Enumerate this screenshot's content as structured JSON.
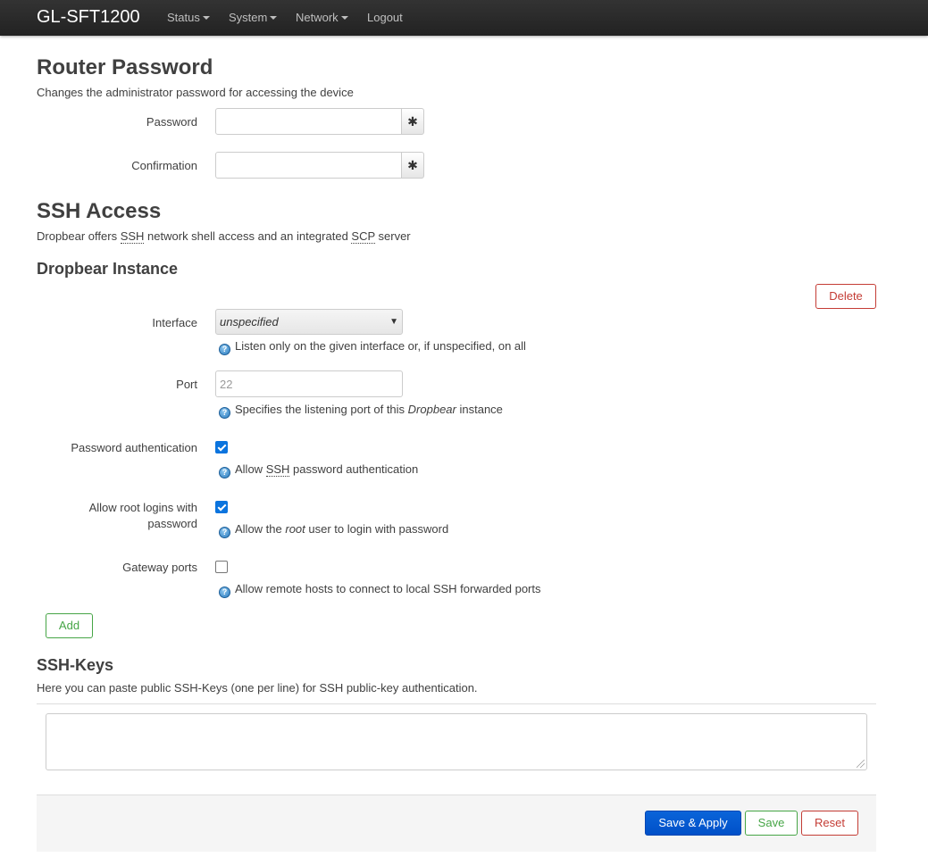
{
  "navbar": {
    "brand": "GL-SFT1200",
    "menus": [
      {
        "label": "Status"
      },
      {
        "label": "System"
      },
      {
        "label": "Network"
      }
    ],
    "logout": "Logout"
  },
  "router_password": {
    "title": "Router Password",
    "description": "Changes the administrator password for accessing the device",
    "password_label": "Password",
    "confirmation_label": "Confirmation",
    "reveal_symbol": "✱"
  },
  "ssh_access": {
    "title": "SSH Access",
    "desc_prefix": "Dropbear offers ",
    "desc_ssh": "SSH",
    "desc_middle": " network shell access and an integrated ",
    "desc_scp": "SCP",
    "desc_suffix": " server",
    "instance_title": "Dropbear Instance",
    "delete_label": "Delete",
    "interface": {
      "label": "Interface",
      "value": "unspecified",
      "arrow": "▼",
      "hint": "Listen only on the given interface or, if unspecified, on all"
    },
    "port": {
      "label": "Port",
      "placeholder": "22",
      "hint_prefix": "Specifies the listening port of this ",
      "hint_em": "Dropbear",
      "hint_suffix": " instance"
    },
    "password_auth": {
      "label": "Password authentication",
      "checked": true,
      "hint_prefix": "Allow ",
      "hint_abbr": "SSH",
      "hint_suffix": " password authentication"
    },
    "root_login": {
      "label_line1": "Allow root logins with",
      "label_line2": "password",
      "checked": true,
      "hint_prefix": "Allow the ",
      "hint_em": "root",
      "hint_suffix": " user to login with password"
    },
    "gateway_ports": {
      "label": "Gateway ports",
      "checked": false,
      "hint": "Allow remote hosts to connect to local SSH forwarded ports"
    },
    "add_label": "Add"
  },
  "ssh_keys": {
    "title": "SSH-Keys",
    "description": "Here you can paste public SSH-Keys (one per line) for SSH public-key authentication."
  },
  "actions": {
    "save_apply": "Save & Apply",
    "save": "Save",
    "reset": "Reset"
  },
  "help_icon_glyph": "?"
}
